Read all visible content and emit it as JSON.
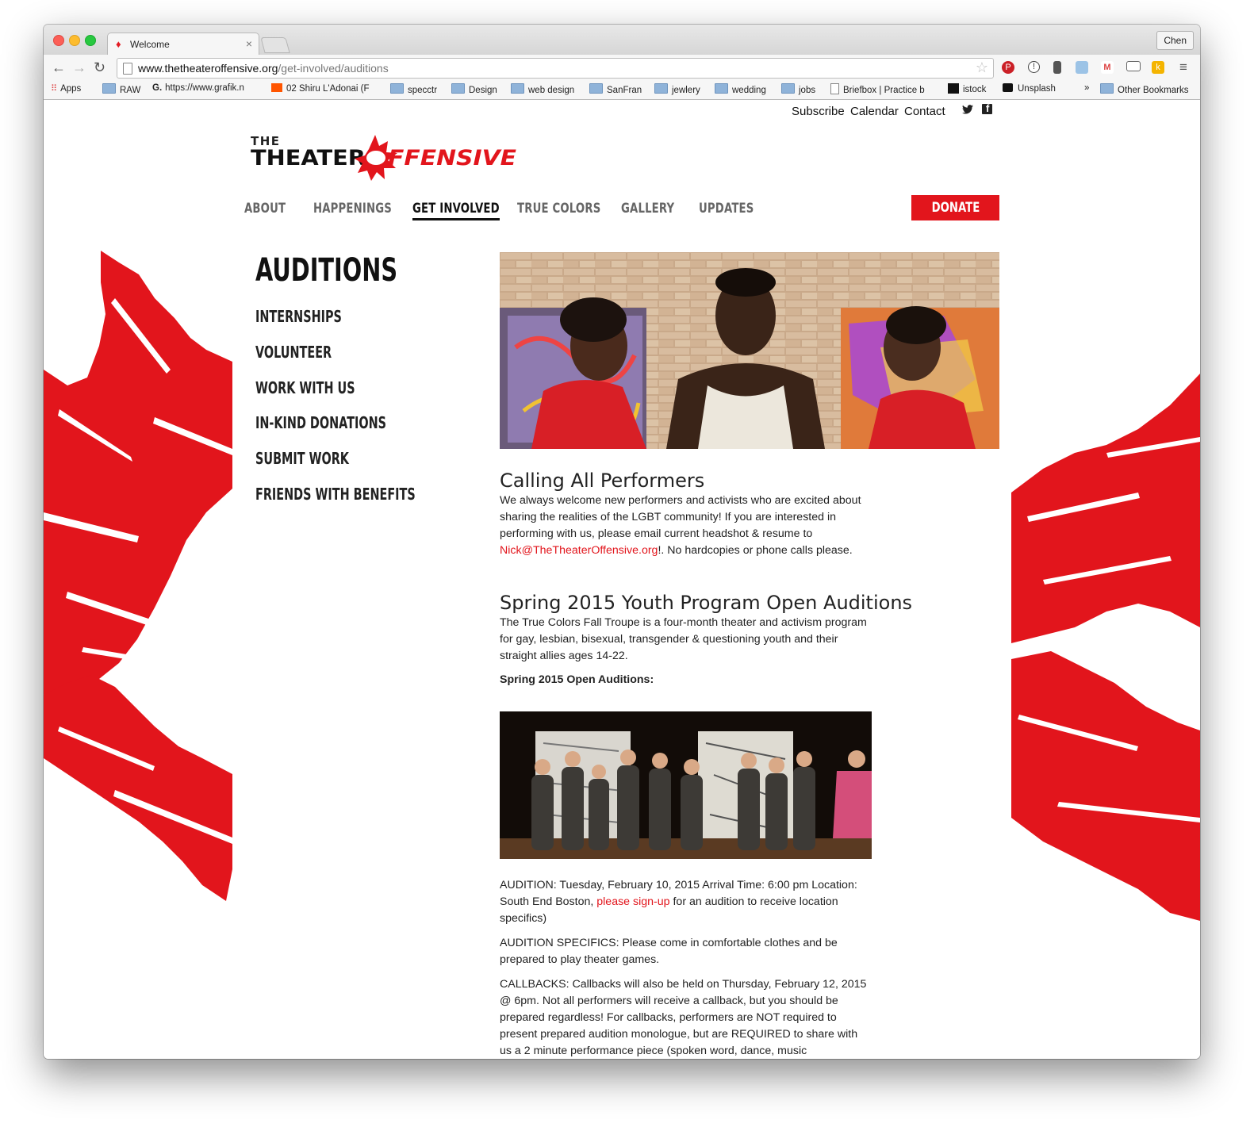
{
  "browser": {
    "tab_title": "Welcome",
    "profile": "Chen",
    "url_domain": "www.thetheateroffensive.org",
    "url_path": "/get-involved/auditions",
    "bookmarks": [
      {
        "label": "Apps"
      },
      {
        "label": "RAW"
      },
      {
        "label": "https://www.grafik.n"
      },
      {
        "label": "02 Shiru L'Adonai (F"
      },
      {
        "label": "specctr"
      },
      {
        "label": "Design"
      },
      {
        "label": "web design"
      },
      {
        "label": "SanFran"
      },
      {
        "label": "jewlery"
      },
      {
        "label": "wedding"
      },
      {
        "label": "jobs"
      },
      {
        "label": "Briefbox | Practice b"
      },
      {
        "label": "istock"
      },
      {
        "label": "Unsplash"
      }
    ],
    "more_bookmarks": "»",
    "other_bookmarks": "Other Bookmarks"
  },
  "site": {
    "utility_links": [
      "Subscribe",
      "Calendar",
      "Contact"
    ],
    "logo": {
      "the": "THE",
      "theater": "THEATER",
      "offensive": "FFENSIVE"
    },
    "nav": [
      "ABOUT",
      "HAPPENINGS",
      "GET INVOLVED",
      "TRUE COLORS",
      "GALLERY",
      "UPDATES"
    ],
    "donate": "DONATE",
    "accent": "#e2151c"
  },
  "sidebar": {
    "title": "AUDITIONS",
    "items": [
      "INTERNSHIPS",
      "VOLUNTEER",
      "WORK WITH US",
      "IN-KIND DONATIONS",
      "SUBMIT WORK",
      "FRIENDS WITH BENEFITS"
    ]
  },
  "main": {
    "section1_title": "Calling All Performers",
    "section1_text_a": "We always welcome new performers and activists who are excited about sharing the realities of the LGBT community! If you are interested in performing with us, please email current headshot & resume to ",
    "section1_link": "Nick@TheTheaterOffensive.org",
    "section1_text_b": "!. No hardcopies or phone calls please.",
    "section2_title": "Spring 2015 Youth Program Open Auditions",
    "section2_text": "The True Colors Fall Troupe is a four-month theater and activism program for gay, lesbian, bisexual, transgender & questioning youth and their straight allies ages 14-22.",
    "section2_sub": "Spring 2015 Open Auditions:",
    "audition_a": "AUDITION: Tuesday, February 10, 2015 Arrival Time: 6:00 pm Location: South End Boston, ",
    "audition_link": "please sign-up",
    "audition_b": " for an audition to receive location specifics)",
    "specifics": "AUDITION SPECIFICS: Please come in comfortable clothes and be prepared to play theater games.",
    "callbacks": "CALLBACKS: Callbacks will also be held on Thursday, February 12, 2015 @ 6pm. Not all performers will receive a callback, but you should be prepared regardless! For callbacks, performers are NOT required to present prepared audition monologue, but are REQUIRED to share with us a 2 minute performance piece (spoken word, dance, music"
  }
}
